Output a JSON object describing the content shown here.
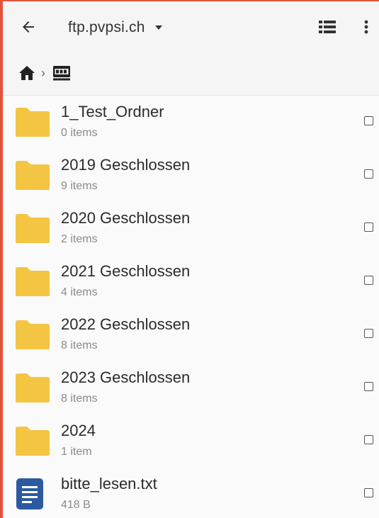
{
  "appbar": {
    "title": "ftp.pvpsi.ch",
    "icons": {
      "back": "arrow-left-icon",
      "dropdown": "caret-down-icon",
      "view": "list-view-icon",
      "more": "more-vert-icon"
    }
  },
  "breadcrumb": {
    "home_icon": "home-icon",
    "separator": "›",
    "current_icon": "ftp-server-icon"
  },
  "items": [
    {
      "name": "1_Test_Ordner",
      "meta": "0 items",
      "type": "folder"
    },
    {
      "name": "2019 Geschlossen",
      "meta": "9 items",
      "type": "folder"
    },
    {
      "name": "2020 Geschlossen",
      "meta": "2 items",
      "type": "folder"
    },
    {
      "name": "2021 Geschlossen",
      "meta": "4 items",
      "type": "folder"
    },
    {
      "name": "2022 Geschlossen",
      "meta": "8 items",
      "type": "folder"
    },
    {
      "name": "2023 Geschlossen",
      "meta": "8 items",
      "type": "folder"
    },
    {
      "name": "2024",
      "meta": "1 item",
      "type": "folder"
    },
    {
      "name": "bitte_lesen.txt",
      "meta": "418 B",
      "type": "text-file"
    }
  ],
  "colors": {
    "folder": "#f4c542",
    "text_file": "#2c5aa0",
    "accent_border": "#e0533a"
  }
}
